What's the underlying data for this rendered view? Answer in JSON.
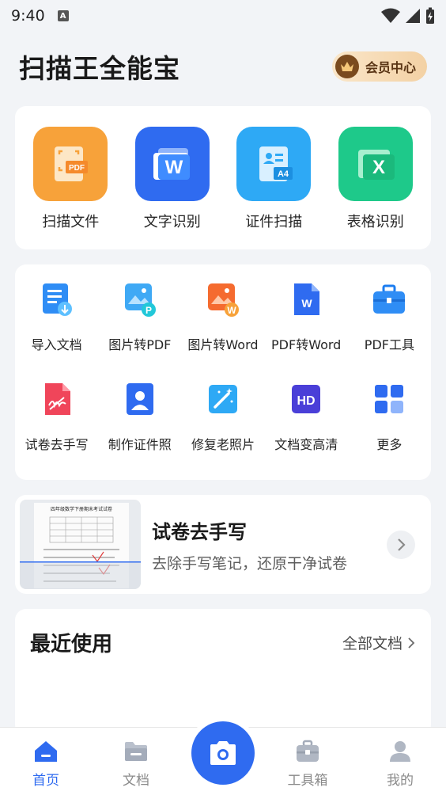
{
  "status": {
    "time": "9:40",
    "a_icon": "A"
  },
  "header": {
    "title": "扫描王全能宝",
    "vip_label": "会员中心"
  },
  "main_tools": [
    {
      "label": "扫描文件",
      "icon": "pdf-scan-icon",
      "color": "#f7a23a"
    },
    {
      "label": "文字识别",
      "icon": "word-icon",
      "color": "#2f6bf0"
    },
    {
      "label": "证件扫描",
      "icon": "id-card-icon",
      "color": "#2ea9f5"
    },
    {
      "label": "表格识别",
      "icon": "excel-icon",
      "color": "#1ec98a"
    }
  ],
  "more_tools": [
    {
      "label": "导入文档",
      "icon": "import-doc-icon"
    },
    {
      "label": "图片转PDF",
      "icon": "image-to-pdf-icon"
    },
    {
      "label": "图片转Word",
      "icon": "image-to-word-icon"
    },
    {
      "label": "PDF转Word",
      "icon": "pdf-to-word-icon"
    },
    {
      "label": "PDF工具",
      "icon": "toolbox-icon"
    },
    {
      "label": "试卷去手写",
      "icon": "erase-handwriting-icon"
    },
    {
      "label": "制作证件照",
      "icon": "id-photo-icon"
    },
    {
      "label": "修复老照片",
      "icon": "repair-photo-icon"
    },
    {
      "label": "文档变高清",
      "icon": "hd-icon"
    },
    {
      "label": "更多",
      "icon": "more-grid-icon"
    }
  ],
  "banner": {
    "title": "试卷去手写",
    "subtitle": "去除手写笔记，还原干净试卷",
    "image_caption": "四年级数学下册期末考试试卷"
  },
  "recent": {
    "title": "最近使用",
    "all_label": "全部文档"
  },
  "tabs": [
    {
      "label": "首页",
      "icon": "home-icon",
      "active": true
    },
    {
      "label": "文档",
      "icon": "folder-icon",
      "active": false
    },
    {
      "label": "工具箱",
      "icon": "toolbox-icon",
      "active": false
    },
    {
      "label": "我的",
      "icon": "user-icon",
      "active": false
    }
  ]
}
